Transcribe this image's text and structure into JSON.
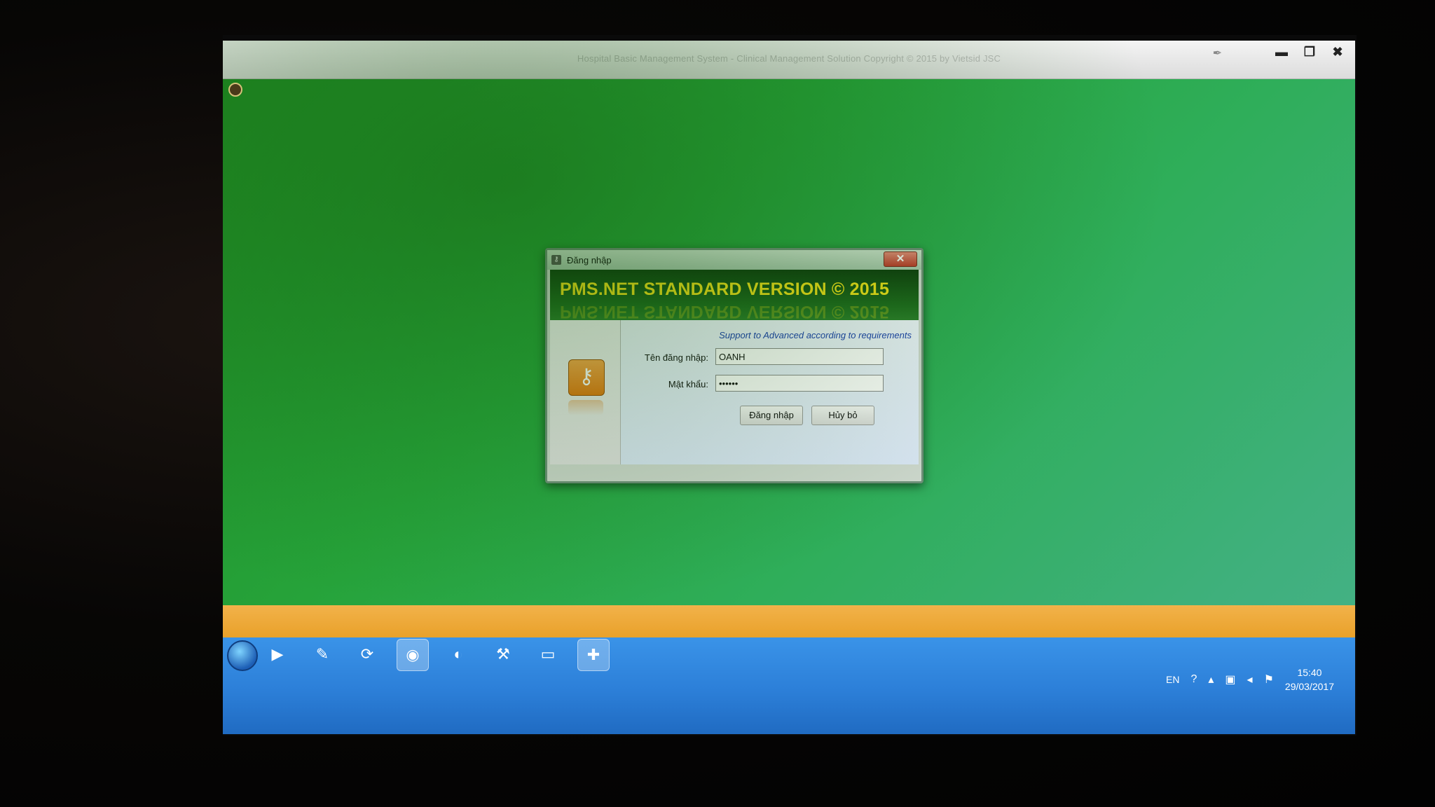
{
  "app": {
    "title": "Hospital Basic Management System - Clinical Management Solution Copyright © 2015  by Vietsid JSC",
    "controls": {
      "minimize": "▬",
      "restore": "❐",
      "close": "✖"
    }
  },
  "dialog": {
    "title": "Đăng nhập",
    "close_label": "✕",
    "banner_title": "PMS.NET STANDARD VERSION © 2015",
    "support_text": "Support to Advanced according to requirements",
    "username_label": "Tên đăng nhập:",
    "username_value": "OANH",
    "password_label": "Mật khẩu:",
    "password_value": "••••••",
    "login_button": "Đăng nhập",
    "cancel_button": "Hủy bỏ",
    "key_icon": "key-icon"
  },
  "taskbar": {
    "pinned": [
      {
        "name": "media-player-icon",
        "glyph": "▶"
      },
      {
        "name": "paint-icon",
        "glyph": "✎"
      },
      {
        "name": "green-app-icon",
        "glyph": "⟳"
      },
      {
        "name": "chrome-icon",
        "glyph": "◉"
      },
      {
        "name": "firefox-icon",
        "glyph": "◐"
      },
      {
        "name": "tools-icon",
        "glyph": "⚒"
      },
      {
        "name": "folder-icon",
        "glyph": "▭"
      },
      {
        "name": "pms-app-icon",
        "glyph": "✚"
      }
    ],
    "tray": {
      "language": "EN",
      "time": "15:40",
      "date": "29/03/2017"
    }
  },
  "colors": {
    "desktop_green": "#26a33a",
    "banner_text": "#f2e21a",
    "support_text": "#1a3fb0",
    "taskbar_blue": "#2c7fd8",
    "orange_strip": "#e9a12a"
  }
}
